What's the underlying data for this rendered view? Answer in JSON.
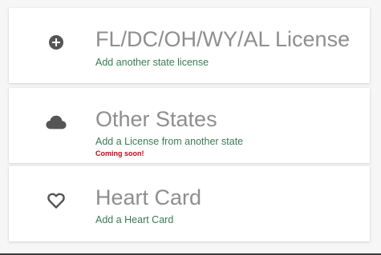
{
  "cards": [
    {
      "icon": "plus-circle-icon",
      "title": "FL/DC/OH/WY/AL License",
      "subtitle": "Add another state license"
    },
    {
      "icon": "cloud-icon",
      "title": "Other States",
      "subtitle": "Add a License from another state",
      "note": "Coming soon!"
    },
    {
      "icon": "heart-outline-icon",
      "title": "Heart Card",
      "subtitle": "Add a Heart Card"
    }
  ],
  "colors": {
    "title": "#8e8e8e",
    "subtitle": "#3b7a55",
    "note": "#d0021b",
    "icon": "#555555"
  }
}
